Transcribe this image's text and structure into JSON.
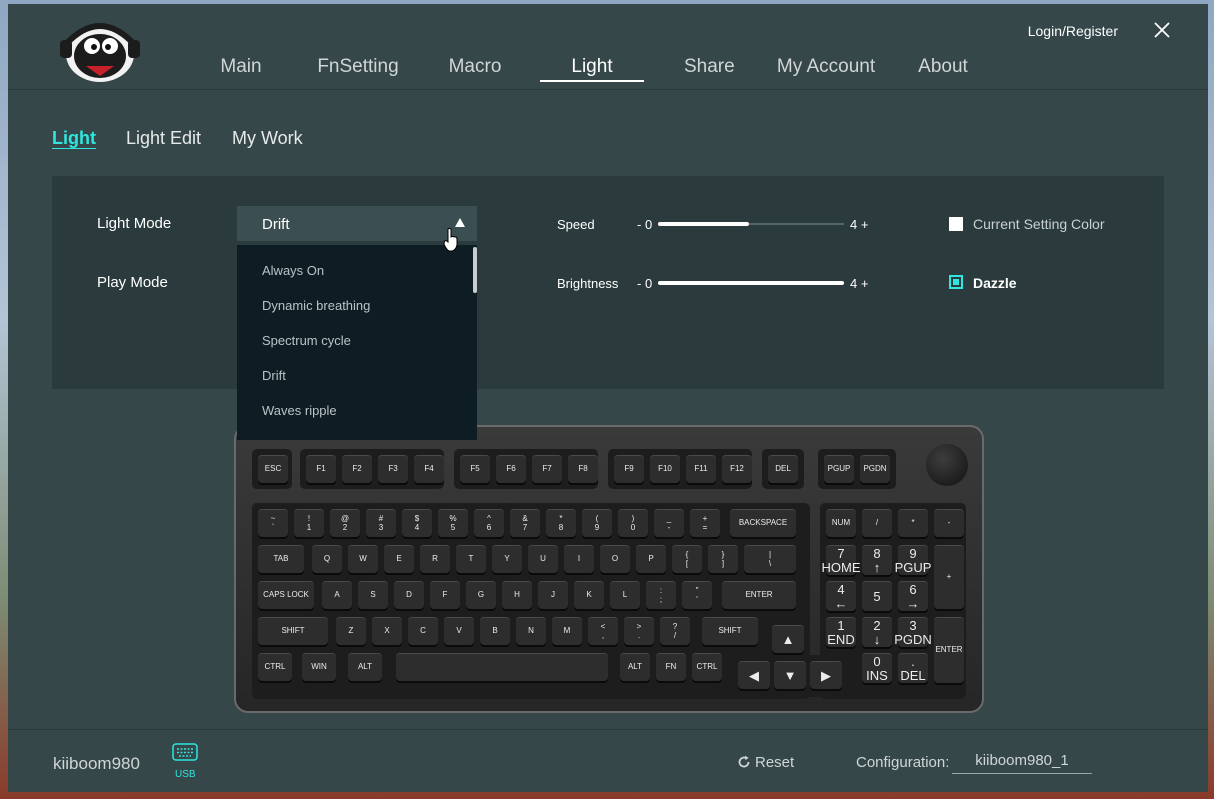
{
  "header": {
    "nav": [
      {
        "label": "Main"
      },
      {
        "label": "FnSetting"
      },
      {
        "label": "Macro"
      },
      {
        "label": "Light"
      },
      {
        "label": "Share"
      },
      {
        "label": "My Account"
      },
      {
        "label": "About"
      }
    ],
    "active_nav": "Light",
    "login_label": "Login/Register",
    "close_icon": "close-icon"
  },
  "subtabs": [
    {
      "label": "Light"
    },
    {
      "label": "Light Edit"
    },
    {
      "label": "My Work"
    }
  ],
  "settings": {
    "light_mode_label": "Light Mode",
    "play_mode_label": "Play Mode",
    "light_mode_value": "Drift",
    "dropdown_options": [
      "Always On",
      "Dynamic breathing",
      "Spectrum cycle",
      "Drift",
      "Waves ripple"
    ],
    "speed": {
      "label": "Speed",
      "min_label": "- 0",
      "max_label": "4 +",
      "fraction": 0.49
    },
    "brightness": {
      "label": "Brightness",
      "min_label": "- 0",
      "max_label": "4 +",
      "fraction": 1.0
    },
    "current_color_label": "Current Setting Color",
    "current_color_checked": false,
    "dazzle_label": "Dazzle",
    "dazzle_checked": true
  },
  "keyboard": {
    "row_fn": [
      "ESC",
      "F1",
      "F2",
      "F3",
      "F4",
      "F5",
      "F6",
      "F7",
      "F8",
      "F9",
      "F10",
      "F11",
      "F12",
      "DEL",
      "PGUP",
      "PGDN"
    ],
    "row_num": [
      "~\n`",
      "!\n1",
      "@\n2",
      "#\n3",
      "$\n4",
      "%\n5",
      "^\n6",
      "&\n7",
      "*\n8",
      "(\n9",
      ")\n0",
      "_\n-",
      "+\n=",
      "BACKSPACE"
    ],
    "row_tab": [
      "TAB",
      "Q",
      "W",
      "E",
      "R",
      "T",
      "Y",
      "U",
      "I",
      "O",
      "P",
      "{\n[",
      "}\n]",
      "|\n\\"
    ],
    "row_caps": [
      "CAPS LOCK",
      "A",
      "S",
      "D",
      "F",
      "G",
      "H",
      "J",
      "K",
      "L",
      ":\n;",
      "\"\n'",
      "ENTER"
    ],
    "row_shift": [
      "SHIFT",
      "Z",
      "X",
      "C",
      "V",
      "B",
      "N",
      "M",
      "<\n,",
      ">\n.",
      "?\n/",
      "SHIFT"
    ],
    "row_ctrl": [
      "CTRL",
      "WIN",
      "ALT",
      "",
      "ALT",
      "FN",
      "CTRL"
    ],
    "arrows": [
      "▲",
      "◀",
      "▼",
      "▶"
    ],
    "numpad": [
      "NUM",
      "/",
      "*",
      "-",
      "7\nHOME",
      "8\n↑",
      "9\nPGUP",
      "+",
      "4\n←",
      "5",
      "6\n→",
      "1\nEND",
      "2\n↓",
      "3\nPGDN",
      "ENTER",
      "0\nINS",
      ".\nDEL"
    ]
  },
  "footer": {
    "device_name": "kiiboom980",
    "connection_label": "USB",
    "reset_label": "Reset",
    "config_label": "Configuration:",
    "config_value": "kiiboom980_1"
  },
  "colors": {
    "accent": "#2ee6df",
    "background": "#354749",
    "panel": "#2b3b3d"
  }
}
